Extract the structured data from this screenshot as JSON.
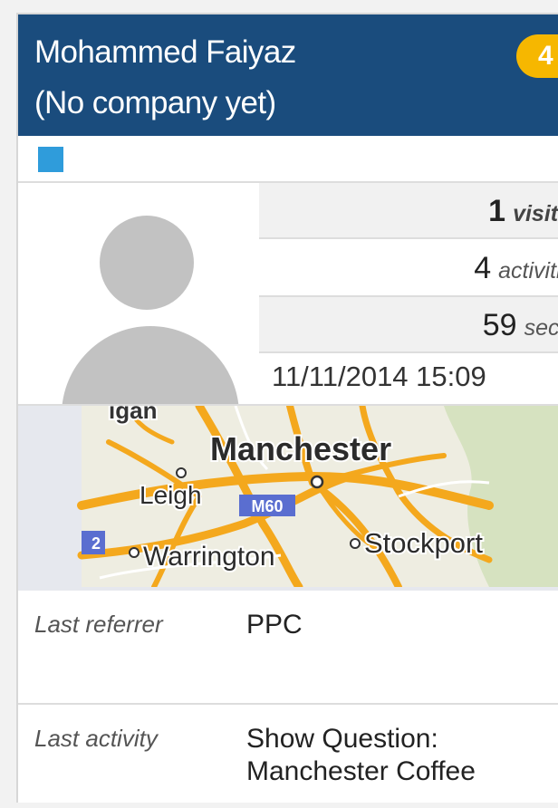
{
  "contact": {
    "name": "Mohammed Faiyaz",
    "company": "(No company yet)",
    "badge": "4"
  },
  "tag": {
    "color": "#2f9cdb"
  },
  "stats": {
    "visits": {
      "value": "1",
      "unit": "visits"
    },
    "activities": {
      "value": "4",
      "unit": "activities"
    },
    "time": {
      "value": "59",
      "unit": "secs"
    },
    "last_visit": "11/11/2014 15:09"
  },
  "map": {
    "cities": {
      "manchester": "Manchester",
      "leigh": "Leigh",
      "warrington": "Warrington",
      "stockport": "Stockport",
      "wigan_partial": "igan"
    },
    "road_shields": {
      "m60": "M60",
      "m62_partial": "2"
    }
  },
  "details": {
    "referrer": {
      "label": "Last referrer",
      "value": "PPC"
    },
    "activity": {
      "label": "Last activity",
      "value_line1": "Show Question:",
      "value_line2": "Manchester Coffee"
    }
  },
  "colors": {
    "header": "#1a4c7d",
    "badge": "#f6b700",
    "avatar": "#c2c2c2",
    "road": "#f4a81d"
  }
}
